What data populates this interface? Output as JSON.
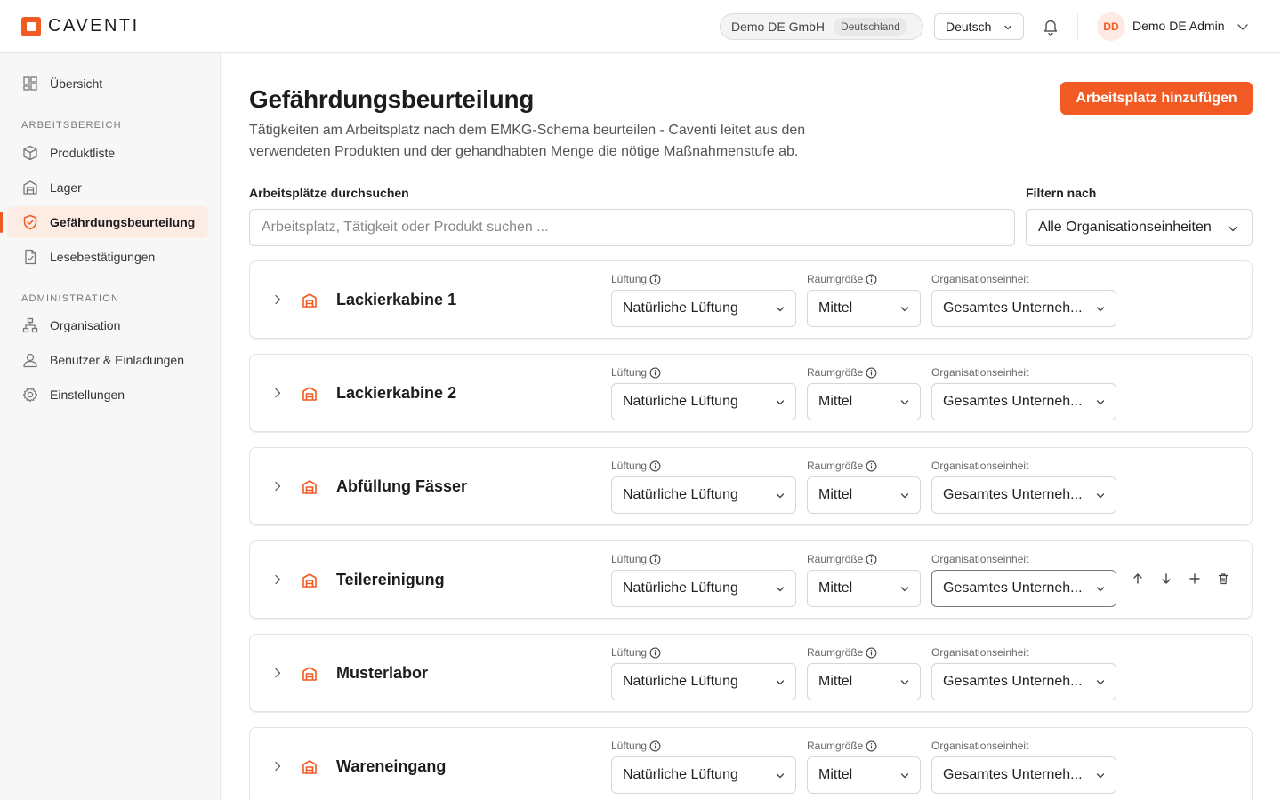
{
  "brand": {
    "name": "CAVENTI",
    "color": "#f15a22"
  },
  "header": {
    "org_name": "Demo DE GmbH",
    "org_country": "Deutschland",
    "language": "Deutsch",
    "user_initials": "DD",
    "user_name": "Demo DE Admin"
  },
  "sidebar": {
    "overview": "Übersicht",
    "section_workspace": "ARBEITSBEREICH",
    "products": "Produktliste",
    "storage": "Lager",
    "risk_assessment": "Gefährdungsbeurteilung",
    "read_confirmations": "Lesebestätigungen",
    "section_admin": "ADMINISTRATION",
    "organisation": "Organisation",
    "users": "Benutzer & Einladungen",
    "settings": "Einstellungen",
    "active_item": "Gefährdungsbeurteilung"
  },
  "main": {
    "title": "Gefährdungsbeurteilung",
    "description": "Tätigkeiten am Arbeitsplatz nach dem EMKG-Schema beurteilen - Caventi leitet aus den verwendeten Produkten und der gehandhabten Menge die nötige Maßnahmenstufe ab.",
    "add_button": "Arbeitsplatz hinzufügen",
    "search_label": "Arbeitsplätze durchsuchen",
    "search_placeholder": "Arbeitsplatz, Tätigkeit oder Produkt suchen ...",
    "search_value": "",
    "filter_label": "Filtern nach",
    "filter_value": "Alle Organisationseinheiten"
  },
  "field_labels": {
    "ventilation": "Lüftung",
    "room_size": "Raumgröße",
    "org_unit": "Organisationseinheit"
  },
  "workplaces": [
    {
      "name": "Lackierkabine 1",
      "ventilation": "Natürliche Lüftung",
      "room_size": "Mittel",
      "org_unit": "Gesamtes Unterneh..."
    },
    {
      "name": "Lackierkabine 2",
      "ventilation": "Natürliche Lüftung",
      "room_size": "Mittel",
      "org_unit": "Gesamtes Unterneh..."
    },
    {
      "name": "Abfüllung Fässer",
      "ventilation": "Natürliche Lüftung",
      "room_size": "Mittel",
      "org_unit": "Gesamtes Unterneh..."
    },
    {
      "name": "Teilereinigung",
      "ventilation": "Natürliche Lüftung",
      "room_size": "Mittel",
      "org_unit": "Gesamtes Unterneh..."
    },
    {
      "name": "Musterlabor",
      "ventilation": "Natürliche Lüftung",
      "room_size": "Mittel",
      "org_unit": "Gesamtes Unterneh..."
    },
    {
      "name": "Wareneingang",
      "ventilation": "Natürliche Lüftung",
      "room_size": "Mittel",
      "org_unit": "Gesamtes Unterneh..."
    }
  ],
  "hovered_row_actions": [
    "arrow-up-icon",
    "arrow-down-icon",
    "plus-icon",
    "trash-icon"
  ]
}
